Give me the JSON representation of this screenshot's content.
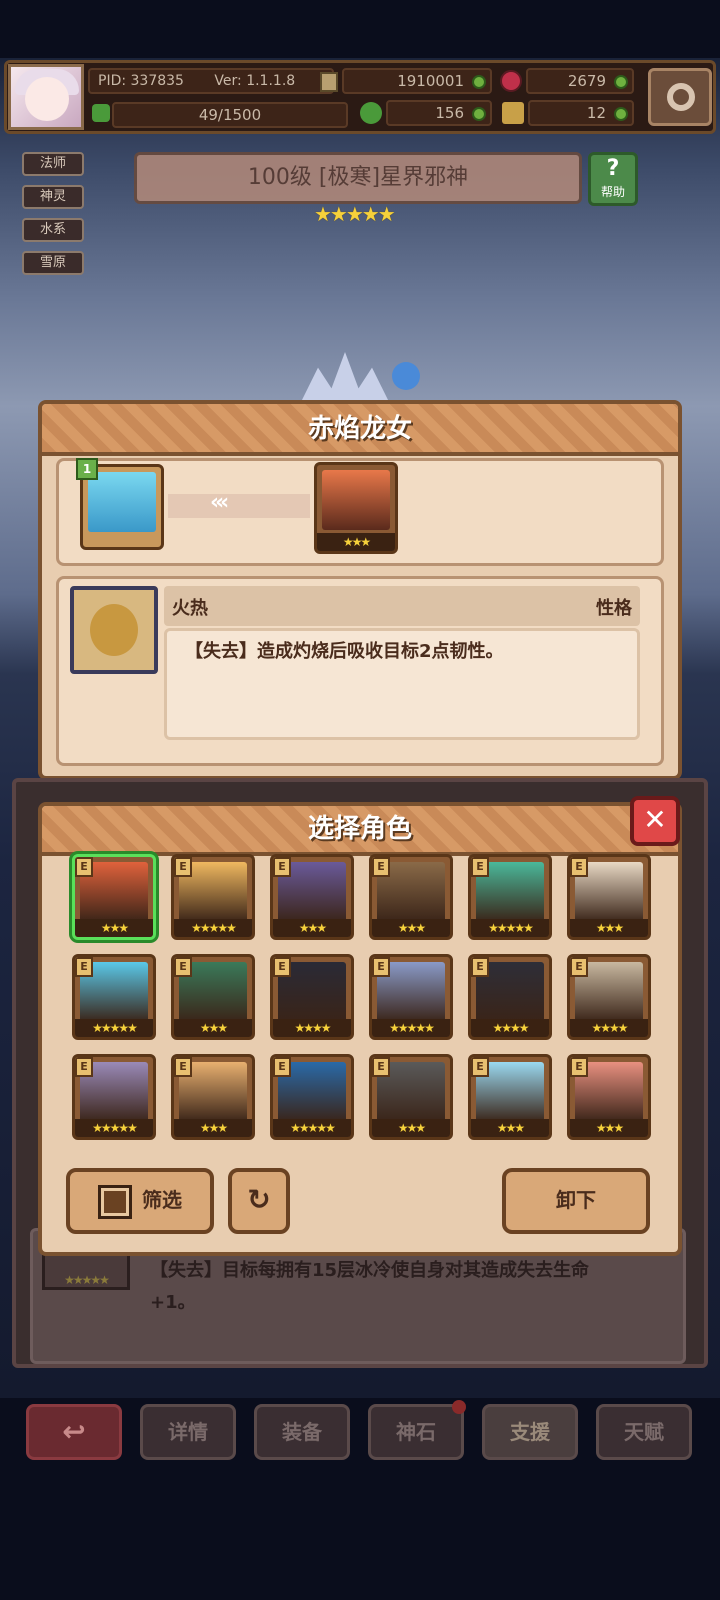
{
  "hud": {
    "pid": "PID: 337835",
    "ver": "Ver: 1.1.1.8",
    "gold": "1910001",
    "gems": "2679",
    "exp": "49/1500",
    "clover": "156",
    "item": "12"
  },
  "tags": [
    "法师",
    "神灵",
    "水系",
    "雪原"
  ],
  "stage": {
    "title": "100级 [极寒]星界邪神",
    "help": "帮助",
    "stars": "★★★★★"
  },
  "popup": {
    "title": "赤焰龙女",
    "slot_badge": "1",
    "target_stars": "★★★",
    "trait_name": "火热",
    "trait_type": "性格",
    "trait_desc": "【失去】造成灼烧后吸收目标2点韧性。"
  },
  "behind_desc": {
    "line1": "【失去】目标每拥有15层冰冷使自身对其造成失去生命",
    "line2": "+1。",
    "stars": "★★★★★"
  },
  "select": {
    "title": "选择角色",
    "filter": "筛选",
    "unload": "卸下",
    "badge": "E",
    "characters": [
      {
        "stars": "★★★",
        "color": "#e0623c"
      },
      {
        "stars": "★★★★★",
        "color": "#f0b860"
      },
      {
        "stars": "★★★",
        "color": "#6a5a9a"
      },
      {
        "stars": "★★★",
        "color": "#8a6a48"
      },
      {
        "stars": "★★★★★",
        "color": "#4ab89a"
      },
      {
        "stars": "★★★",
        "color": "#e8d8c4"
      },
      {
        "stars": "★★★★★",
        "color": "#5ac8e8"
      },
      {
        "stars": "★★★",
        "color": "#3a7a5a"
      },
      {
        "stars": "★★★★",
        "color": "#2a2a36"
      },
      {
        "stars": "★★★★★",
        "color": "#8a9ac8"
      },
      {
        "stars": "★★★★",
        "color": "#2e2e38"
      },
      {
        "stars": "★★★★",
        "color": "#c8b8a0"
      },
      {
        "stars": "★★★★★",
        "color": "#9a8ab8"
      },
      {
        "stars": "★★★",
        "color": "#e8b070"
      },
      {
        "stars": "★★★★★",
        "color": "#2a6aa8"
      },
      {
        "stars": "★★★",
        "color": "#5a5a5a"
      },
      {
        "stars": "★★★",
        "color": "#9ad8f0"
      },
      {
        "stars": "★★★",
        "color": "#e89080"
      }
    ]
  },
  "nav": [
    "详情",
    "装备",
    "神石",
    "支援",
    "天赋"
  ]
}
